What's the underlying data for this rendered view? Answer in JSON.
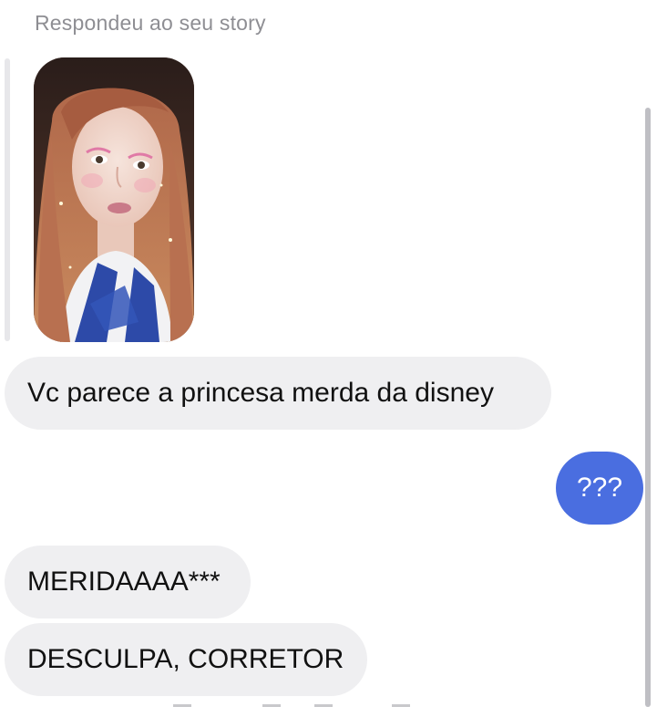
{
  "chat": {
    "reply_context_label": "Respondeu ao seu story",
    "messages": [
      {
        "sender": "them",
        "text": "Vc parece a princesa merda da disney"
      },
      {
        "sender": "me",
        "text": "???"
      },
      {
        "sender": "them",
        "text": "MERIDAAAA***"
      },
      {
        "sender": "them",
        "text": "DESCULPA, CORRETOR"
      }
    ]
  },
  "colors": {
    "incoming_bubble": "#efeff1",
    "outgoing_bubble": "#4a6ee0",
    "label_text": "#8e8e93"
  }
}
